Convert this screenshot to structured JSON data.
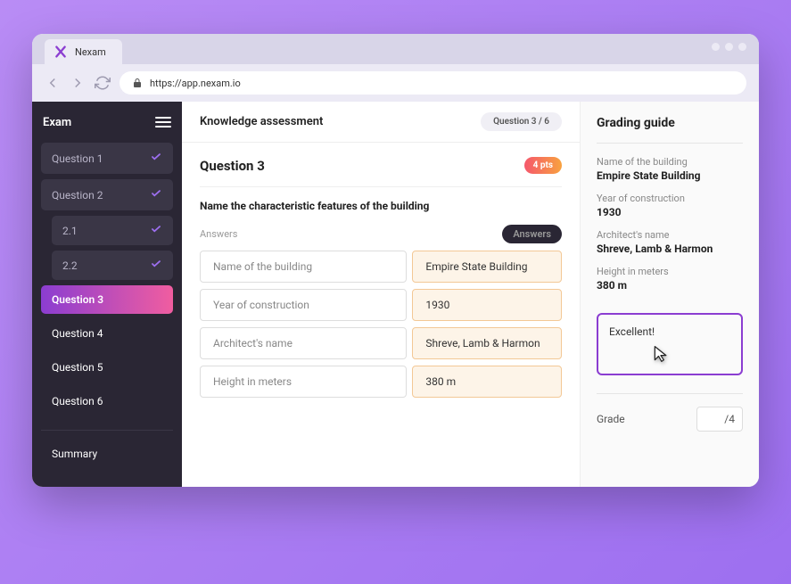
{
  "browser": {
    "tab_title": "Nexam",
    "url": "https://app.nexam.io"
  },
  "sidebar": {
    "title": "Exam",
    "items": [
      {
        "label": "Question 1",
        "type": "done"
      },
      {
        "label": "Question 2",
        "type": "done"
      },
      {
        "label": "2.1",
        "type": "sub"
      },
      {
        "label": "2.2",
        "type": "sub"
      },
      {
        "label": "Question 3",
        "type": "active"
      },
      {
        "label": "Question 4",
        "type": "plain"
      },
      {
        "label": "Question 5",
        "type": "plain"
      },
      {
        "label": "Question 6",
        "type": "plain"
      }
    ],
    "summary": "Summary"
  },
  "main": {
    "assessment_title": "Knowledge assessment",
    "counter": "Question 3 / 6",
    "question_title": "Question 3",
    "points": "4 pts",
    "question_text": "Name the characteristic features of the building",
    "answers_label": "Answers",
    "answers_badge": "Answers",
    "answers": [
      {
        "field": "Name of the building",
        "value": "Empire State Building"
      },
      {
        "field": "Year of construction",
        "value": "1930"
      },
      {
        "field": "Architect's name",
        "value": "Shreve, Lamb & Harmon"
      },
      {
        "field": "Height in meters",
        "value": "380 m"
      }
    ]
  },
  "guide": {
    "title": "Grading guide",
    "items": [
      {
        "label": "Name of the building",
        "value": "Empire State Building"
      },
      {
        "label": "Year of construction",
        "value": "1930"
      },
      {
        "label": "Architect's name",
        "value": "Shreve, Lamb & Harmon"
      },
      {
        "label": "Height in meters",
        "value": "380 m"
      }
    ],
    "comment": "Excellent!",
    "grade_label": "Grade",
    "grade_max": "/4"
  }
}
